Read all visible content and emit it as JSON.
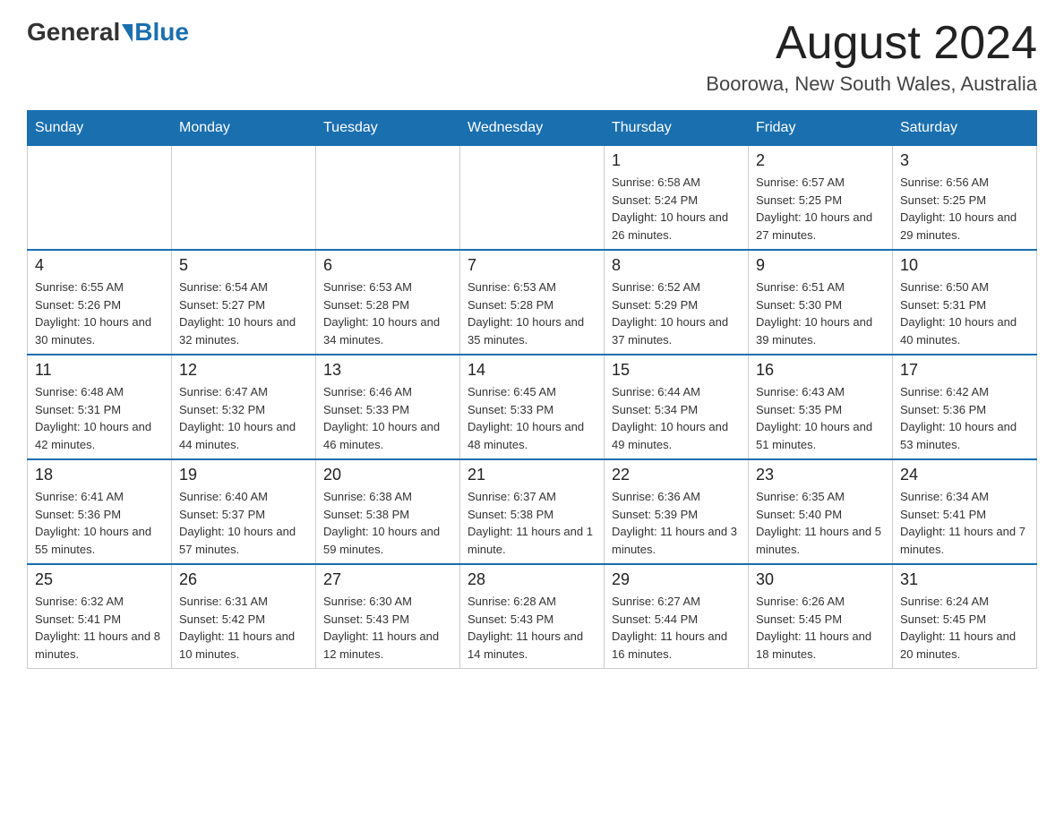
{
  "logo": {
    "general": "General",
    "blue": "Blue"
  },
  "header": {
    "month": "August 2024",
    "location": "Boorowa, New South Wales, Australia"
  },
  "weekdays": [
    "Sunday",
    "Monday",
    "Tuesday",
    "Wednesday",
    "Thursday",
    "Friday",
    "Saturday"
  ],
  "weeks": [
    [
      {
        "day": "",
        "info": ""
      },
      {
        "day": "",
        "info": ""
      },
      {
        "day": "",
        "info": ""
      },
      {
        "day": "",
        "info": ""
      },
      {
        "day": "1",
        "info": "Sunrise: 6:58 AM\nSunset: 5:24 PM\nDaylight: 10 hours and 26 minutes."
      },
      {
        "day": "2",
        "info": "Sunrise: 6:57 AM\nSunset: 5:25 PM\nDaylight: 10 hours and 27 minutes."
      },
      {
        "day": "3",
        "info": "Sunrise: 6:56 AM\nSunset: 5:25 PM\nDaylight: 10 hours and 29 minutes."
      }
    ],
    [
      {
        "day": "4",
        "info": "Sunrise: 6:55 AM\nSunset: 5:26 PM\nDaylight: 10 hours and 30 minutes."
      },
      {
        "day": "5",
        "info": "Sunrise: 6:54 AM\nSunset: 5:27 PM\nDaylight: 10 hours and 32 minutes."
      },
      {
        "day": "6",
        "info": "Sunrise: 6:53 AM\nSunset: 5:28 PM\nDaylight: 10 hours and 34 minutes."
      },
      {
        "day": "7",
        "info": "Sunrise: 6:53 AM\nSunset: 5:28 PM\nDaylight: 10 hours and 35 minutes."
      },
      {
        "day": "8",
        "info": "Sunrise: 6:52 AM\nSunset: 5:29 PM\nDaylight: 10 hours and 37 minutes."
      },
      {
        "day": "9",
        "info": "Sunrise: 6:51 AM\nSunset: 5:30 PM\nDaylight: 10 hours and 39 minutes."
      },
      {
        "day": "10",
        "info": "Sunrise: 6:50 AM\nSunset: 5:31 PM\nDaylight: 10 hours and 40 minutes."
      }
    ],
    [
      {
        "day": "11",
        "info": "Sunrise: 6:48 AM\nSunset: 5:31 PM\nDaylight: 10 hours and 42 minutes."
      },
      {
        "day": "12",
        "info": "Sunrise: 6:47 AM\nSunset: 5:32 PM\nDaylight: 10 hours and 44 minutes."
      },
      {
        "day": "13",
        "info": "Sunrise: 6:46 AM\nSunset: 5:33 PM\nDaylight: 10 hours and 46 minutes."
      },
      {
        "day": "14",
        "info": "Sunrise: 6:45 AM\nSunset: 5:33 PM\nDaylight: 10 hours and 48 minutes."
      },
      {
        "day": "15",
        "info": "Sunrise: 6:44 AM\nSunset: 5:34 PM\nDaylight: 10 hours and 49 minutes."
      },
      {
        "day": "16",
        "info": "Sunrise: 6:43 AM\nSunset: 5:35 PM\nDaylight: 10 hours and 51 minutes."
      },
      {
        "day": "17",
        "info": "Sunrise: 6:42 AM\nSunset: 5:36 PM\nDaylight: 10 hours and 53 minutes."
      }
    ],
    [
      {
        "day": "18",
        "info": "Sunrise: 6:41 AM\nSunset: 5:36 PM\nDaylight: 10 hours and 55 minutes."
      },
      {
        "day": "19",
        "info": "Sunrise: 6:40 AM\nSunset: 5:37 PM\nDaylight: 10 hours and 57 minutes."
      },
      {
        "day": "20",
        "info": "Sunrise: 6:38 AM\nSunset: 5:38 PM\nDaylight: 10 hours and 59 minutes."
      },
      {
        "day": "21",
        "info": "Sunrise: 6:37 AM\nSunset: 5:38 PM\nDaylight: 11 hours and 1 minute."
      },
      {
        "day": "22",
        "info": "Sunrise: 6:36 AM\nSunset: 5:39 PM\nDaylight: 11 hours and 3 minutes."
      },
      {
        "day": "23",
        "info": "Sunrise: 6:35 AM\nSunset: 5:40 PM\nDaylight: 11 hours and 5 minutes."
      },
      {
        "day": "24",
        "info": "Sunrise: 6:34 AM\nSunset: 5:41 PM\nDaylight: 11 hours and 7 minutes."
      }
    ],
    [
      {
        "day": "25",
        "info": "Sunrise: 6:32 AM\nSunset: 5:41 PM\nDaylight: 11 hours and 8 minutes."
      },
      {
        "day": "26",
        "info": "Sunrise: 6:31 AM\nSunset: 5:42 PM\nDaylight: 11 hours and 10 minutes."
      },
      {
        "day": "27",
        "info": "Sunrise: 6:30 AM\nSunset: 5:43 PM\nDaylight: 11 hours and 12 minutes."
      },
      {
        "day": "28",
        "info": "Sunrise: 6:28 AM\nSunset: 5:43 PM\nDaylight: 11 hours and 14 minutes."
      },
      {
        "day": "29",
        "info": "Sunrise: 6:27 AM\nSunset: 5:44 PM\nDaylight: 11 hours and 16 minutes."
      },
      {
        "day": "30",
        "info": "Sunrise: 6:26 AM\nSunset: 5:45 PM\nDaylight: 11 hours and 18 minutes."
      },
      {
        "day": "31",
        "info": "Sunrise: 6:24 AM\nSunset: 5:45 PM\nDaylight: 11 hours and 20 minutes."
      }
    ]
  ]
}
